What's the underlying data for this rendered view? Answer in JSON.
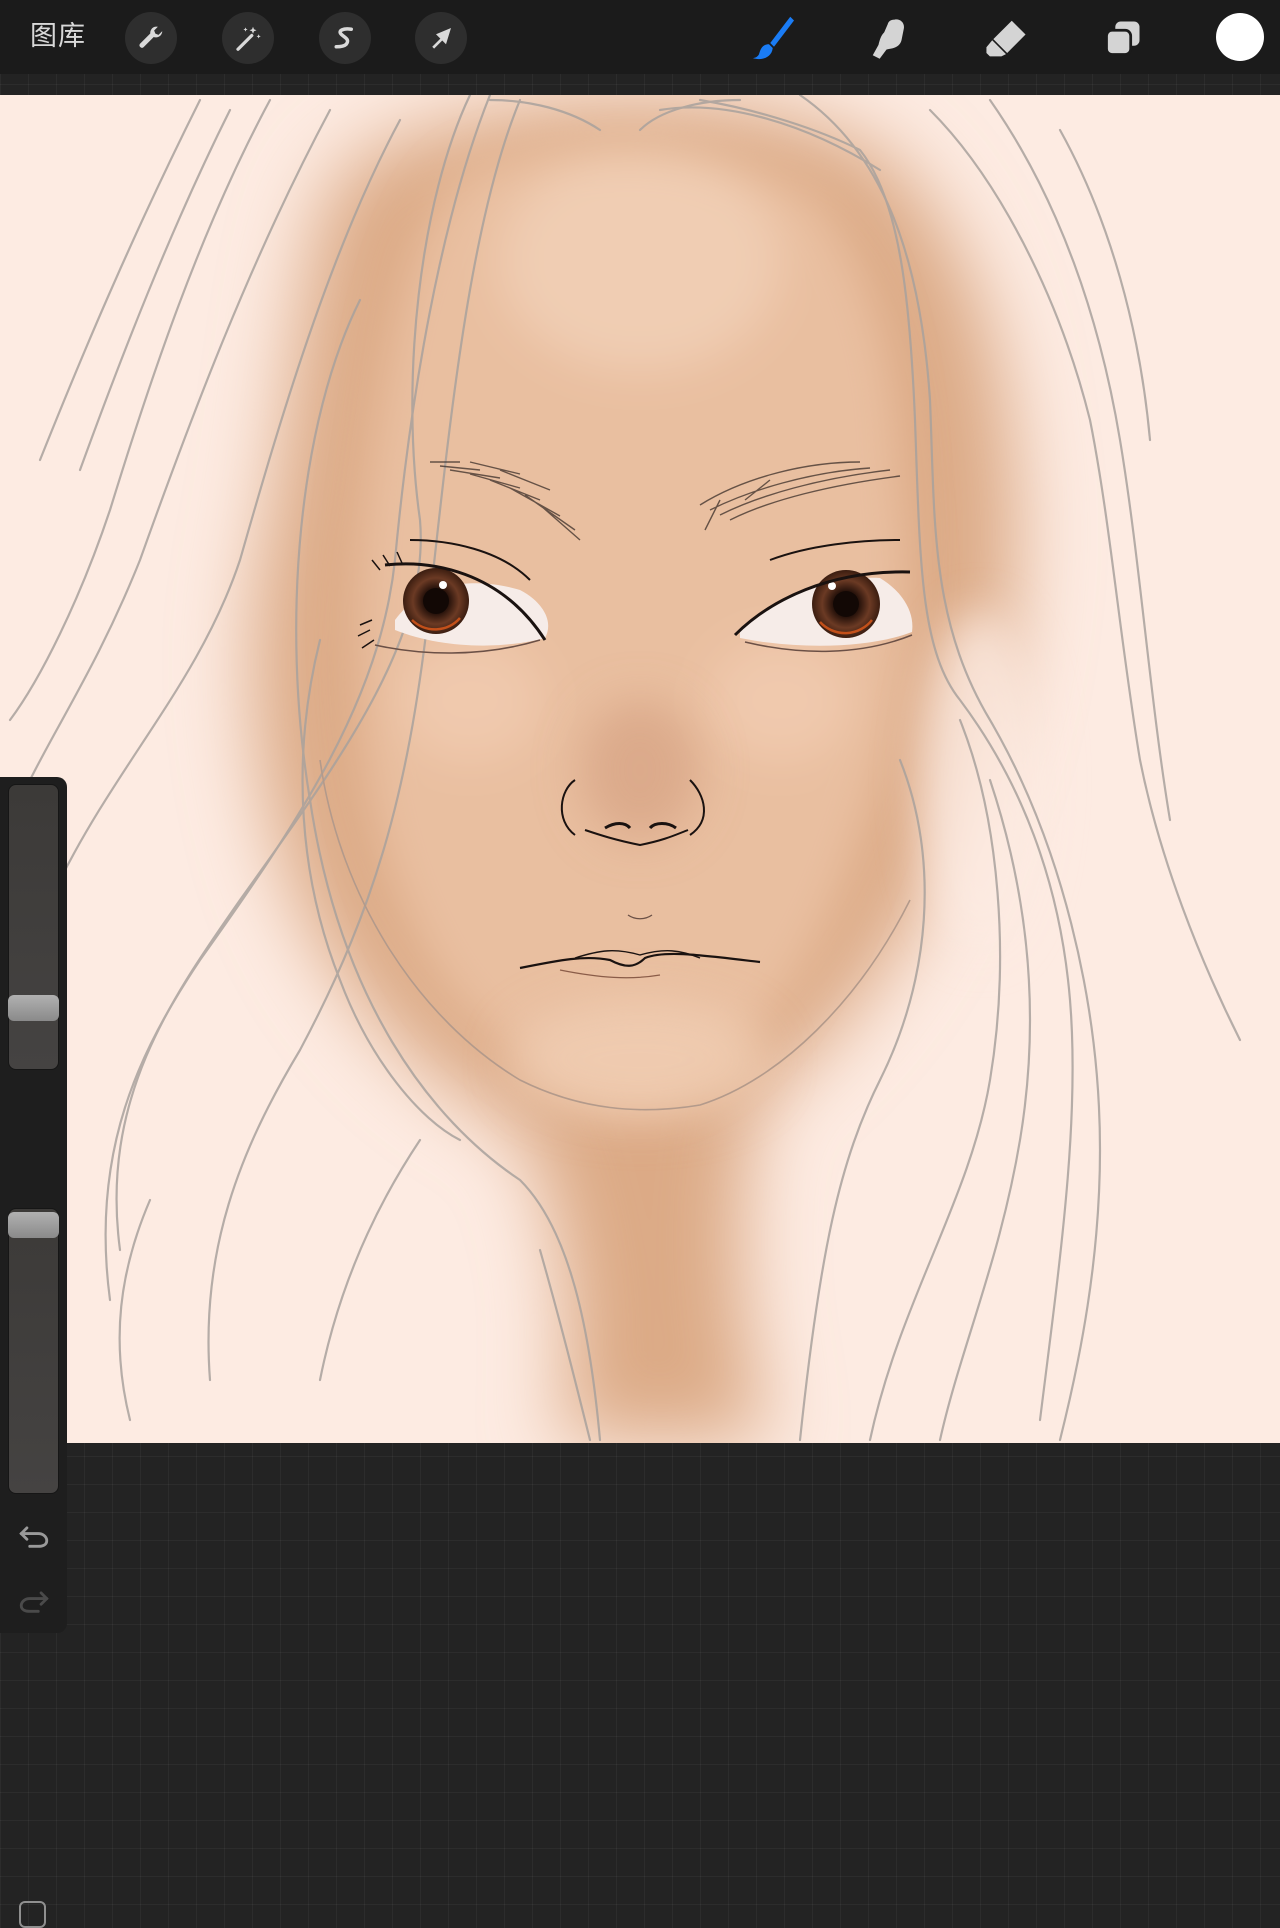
{
  "app": {
    "gallery_label": "图库"
  },
  "toolbar": {
    "left_tools": [
      {
        "name": "actions",
        "icon": "wrench-icon"
      },
      {
        "name": "adjustments",
        "icon": "magic-wand-icon"
      },
      {
        "name": "selection",
        "icon": "selection-s-icon"
      },
      {
        "name": "transform",
        "icon": "arrow-cursor-icon"
      }
    ],
    "right_tools": [
      {
        "name": "brush",
        "icon": "brush-icon",
        "active": true
      },
      {
        "name": "smudge",
        "icon": "smudge-finger-icon",
        "active": false
      },
      {
        "name": "eraser",
        "icon": "eraser-icon",
        "active": false
      },
      {
        "name": "layers",
        "icon": "layers-icon",
        "active": false
      }
    ],
    "active_color": "#ffffff",
    "accent_color": "#1a7cf5"
  },
  "sidebar": {
    "brush_size_level": 0.18,
    "opacity_level": 1.0,
    "icons": [
      "modify-square-icon",
      "undo-icon",
      "redo-icon"
    ]
  },
  "canvas": {
    "background_color": "#fdebe2",
    "skin_color": "#dcaa86",
    "iris_color": "#5a3021"
  }
}
